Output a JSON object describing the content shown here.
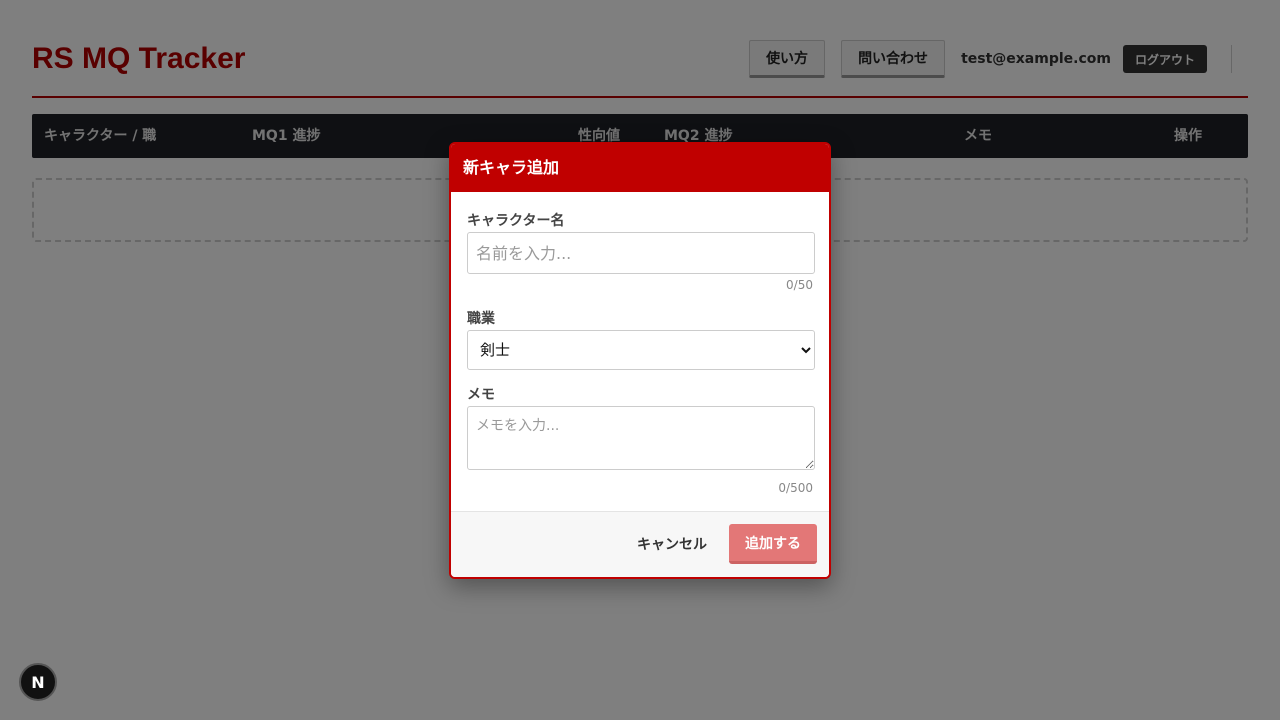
{
  "header": {
    "title": "RS MQ Tracker",
    "help_label": "使い方",
    "contact_label": "問い合わせ",
    "user_email": "test@example.com",
    "logout_label": "ログアウト"
  },
  "table": {
    "columns": [
      "キャラクター / 職",
      "MQ1 進捗",
      "性向値",
      "MQ2 進捗",
      "メモ",
      "操作"
    ]
  },
  "modal": {
    "title": "新キャラ追加",
    "name_label": "キャラクター名",
    "name_placeholder": "名前を入力...",
    "name_counter": "0/50",
    "job_label": "職業",
    "job_selected": "剣士",
    "memo_label": "メモ",
    "memo_placeholder": "メモを入力...",
    "memo_counter": "0/500",
    "cancel_label": "キャンセル",
    "submit_label": "追加する"
  },
  "badge": {
    "letter": "N"
  },
  "colors": {
    "brand": "#b30000",
    "modal_accent": "#c00000",
    "submit_disabled": "#e37777"
  }
}
